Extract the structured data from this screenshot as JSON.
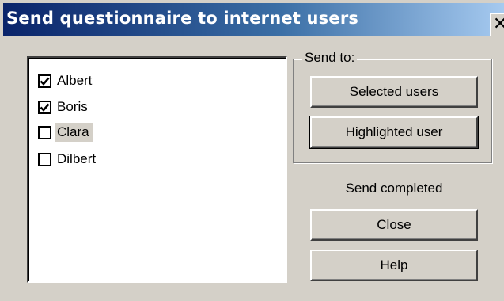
{
  "window": {
    "title": "Send questionnaire to internet users",
    "close_glyph": "✕"
  },
  "users": [
    {
      "name": "Albert",
      "checked": true,
      "highlighted": false
    },
    {
      "name": "Boris",
      "checked": true,
      "highlighted": false
    },
    {
      "name": "Clara",
      "checked": false,
      "highlighted": true
    },
    {
      "name": "Dilbert",
      "checked": false,
      "highlighted": false
    }
  ],
  "send_group": {
    "legend": "Send to:",
    "selected_users_label": "Selected users",
    "highlighted_user_label": "Highlighted user"
  },
  "status": "Send completed",
  "buttons": {
    "close_label": "Close",
    "help_label": "Help"
  },
  "colors": {
    "title_gradient_start": "#0a246a",
    "title_gradient_end": "#a6caf0",
    "face": "#d4d0c8",
    "list_background": "#ffffff"
  },
  "icons": {
    "checkbox_checked": "check-mark-icon",
    "close": "close-icon"
  }
}
